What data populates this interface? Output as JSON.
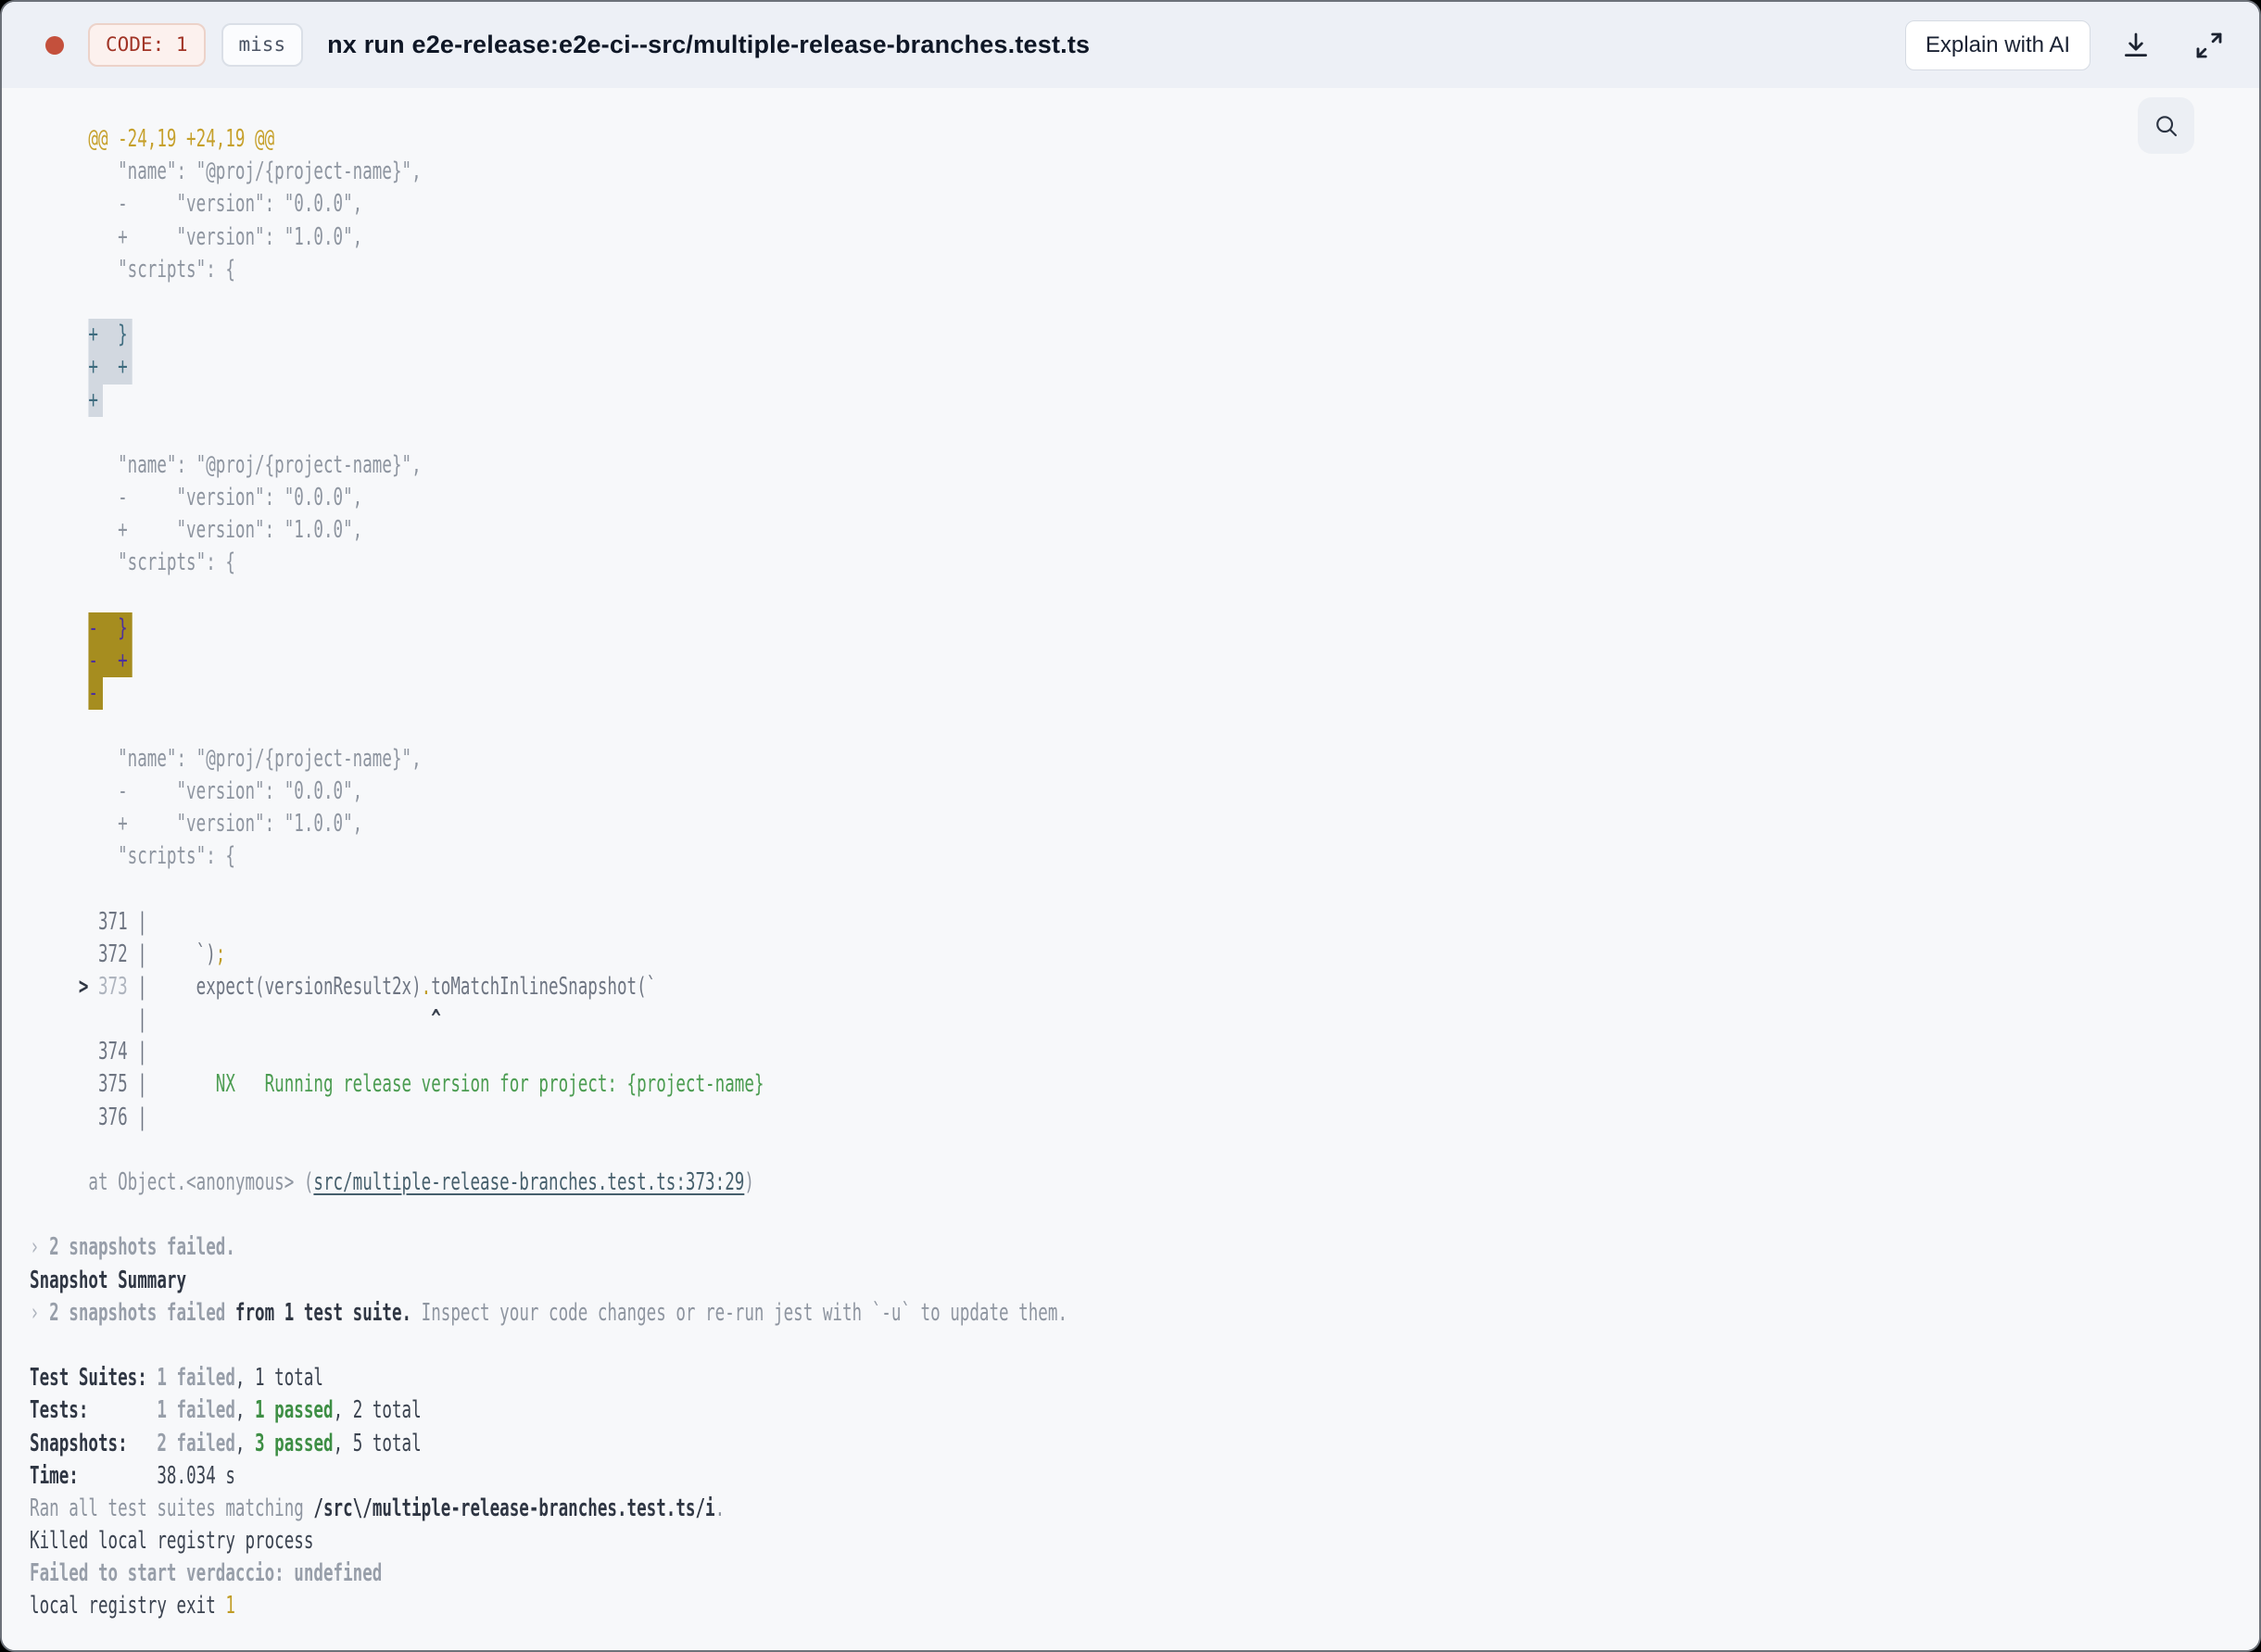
{
  "header": {
    "code_badge": "CODE: 1",
    "cache_badge": "miss",
    "title": "nx run e2e-release:e2e-ci--src/multiple-release-branches.test.ts",
    "explain_button": "Explain with AI",
    "icons": {
      "status": "red-status-dot",
      "download": "download-icon",
      "fullscreen": "expand-icon",
      "search": "search-icon"
    },
    "colors": {
      "header_bg": "#edf0f6",
      "status_dot": "#c4503c",
      "code_badge_text": "#a13426",
      "code_badge_bg": "#fcf1ee"
    }
  },
  "terminal": {
    "colors": {
      "background": "#f7f8fa",
      "hunk_gold": "#c6a02b",
      "diff_gray": "#8e95a0",
      "nx_green": "#4b9c51",
      "match_inactive_bg": "#d2d8e0",
      "match_inactive_fg": "#3d6b7e",
      "match_active_bg": "#a68d1f",
      "match_active_fg": "#4c309e",
      "path_teal": "#465f6c"
    },
    "lines": [
      [
        [
          "hunk",
          "      @@ -24,19 +24,19 @@"
        ]
      ],
      [
        [
          "gray",
          "         \"name\": \"@proj/{project-name}\","
        ]
      ],
      [
        [
          "gray",
          "         -     \"version\": \"0.0.0\","
        ]
      ],
      [
        [
          "gray",
          "         +     \"version\": \"1.0.0\","
        ]
      ],
      [
        [
          "gray",
          "         \"scripts\": {"
        ]
      ],
      [],
      [
        [
          "gray",
          "      "
        ],
        [
          "match1",
          "+  }"
        ]
      ],
      [
        [
          "gray",
          "      "
        ],
        [
          "match1",
          "+  +"
        ]
      ],
      [
        [
          "gray",
          "      "
        ],
        [
          "match1",
          "+"
        ]
      ],
      [],
      [
        [
          "gray",
          "         \"name\": \"@proj/{project-name}\","
        ]
      ],
      [
        [
          "gray",
          "         -     \"version\": \"0.0.0\","
        ]
      ],
      [
        [
          "gray",
          "         +     \"version\": \"1.0.0\","
        ]
      ],
      [
        [
          "gray",
          "         \"scripts\": {"
        ]
      ],
      [],
      [
        [
          "gray",
          "      "
        ],
        [
          "match2",
          "-  }"
        ]
      ],
      [
        [
          "gray",
          "      "
        ],
        [
          "match2",
          "-  +"
        ]
      ],
      [
        [
          "gray",
          "      "
        ],
        [
          "match2",
          "-"
        ]
      ],
      [],
      [
        [
          "gray",
          "         \"name\": \"@proj/{project-name}\","
        ]
      ],
      [
        [
          "gray",
          "         -     \"version\": \"0.0.0\","
        ]
      ],
      [
        [
          "gray",
          "         +     \"version\": \"1.0.0\","
        ]
      ],
      [
        [
          "gray",
          "         \"scripts\": {"
        ]
      ],
      [],
      [
        [
          "code",
          "       371 |"
        ]
      ],
      [
        [
          "code",
          "       372 | "
        ],
        [
          "code",
          "    `)"
        ],
        [
          "gold",
          ";"
        ]
      ],
      [
        [
          "darkbold",
          "     > "
        ],
        [
          "light",
          "373"
        ],
        [
          "code",
          " | "
        ],
        [
          "code",
          "    expect(versionResult2x)"
        ],
        [
          "gold",
          "."
        ],
        [
          "code",
          "toMatchInlineSnapshot(`"
        ]
      ],
      [
        [
          "code",
          "           | "
        ],
        [
          "caret",
          "                            ^"
        ]
      ],
      [
        [
          "code",
          "       374 |"
        ]
      ],
      [
        [
          "code",
          "       375 | "
        ],
        [
          "green",
          "      NX   Running release version for project: {project-name}"
        ]
      ],
      [
        [
          "code",
          "       376 |"
        ]
      ],
      [],
      [
        [
          "gray",
          "      at Object.<anonymous> ("
        ],
        [
          "teal",
          "src/multiple-release-branches.test.ts:373:29"
        ],
        [
          "gray",
          ")"
        ]
      ],
      [],
      [
        [
          "light",
          "› "
        ],
        [
          "graybold",
          "2 snapshots failed."
        ]
      ],
      [
        [
          "darkbold",
          "Snapshot Summary"
        ]
      ],
      [
        [
          "light",
          "› "
        ],
        [
          "graybold",
          "2 snapshots failed"
        ],
        [
          "darkbold",
          " from 1 test suite."
        ],
        [
          "gray",
          " Inspect your code changes or re-run jest with `-u` to update them."
        ]
      ],
      [],
      [
        [
          "darkbold",
          "Test Suites: "
        ],
        [
          "graybold",
          "1 failed"
        ],
        [
          "dark",
          ", 1 total"
        ]
      ],
      [
        [
          "darkbold",
          "Tests:"
        ],
        [
          "dark",
          "       "
        ],
        [
          "graybold",
          "1 failed"
        ],
        [
          "dark",
          ", "
        ],
        [
          "greenbold",
          "1 passed"
        ],
        [
          "dark",
          ", 2 total"
        ]
      ],
      [
        [
          "darkbold",
          "Snapshots:"
        ],
        [
          "dark",
          "   "
        ],
        [
          "graybold",
          "2 failed"
        ],
        [
          "dark",
          ", "
        ],
        [
          "greenbold",
          "3 passed"
        ],
        [
          "dark",
          ", 5 total"
        ]
      ],
      [
        [
          "darkbold",
          "Time:"
        ],
        [
          "dark",
          "        38.034 s"
        ]
      ],
      [
        [
          "gray",
          "Ran all test suites matching "
        ],
        [
          "darkbold",
          "/src\\/multiple-release-branches.test.ts/i"
        ],
        [
          "gray",
          "."
        ]
      ],
      [
        [
          "dark",
          "Killed local registry process"
        ]
      ],
      [
        [
          "graybold",
          "Failed to start verdaccio: undefined"
        ]
      ],
      [
        [
          "dark",
          "local registry exit "
        ],
        [
          "gold",
          "1"
        ]
      ]
    ]
  }
}
